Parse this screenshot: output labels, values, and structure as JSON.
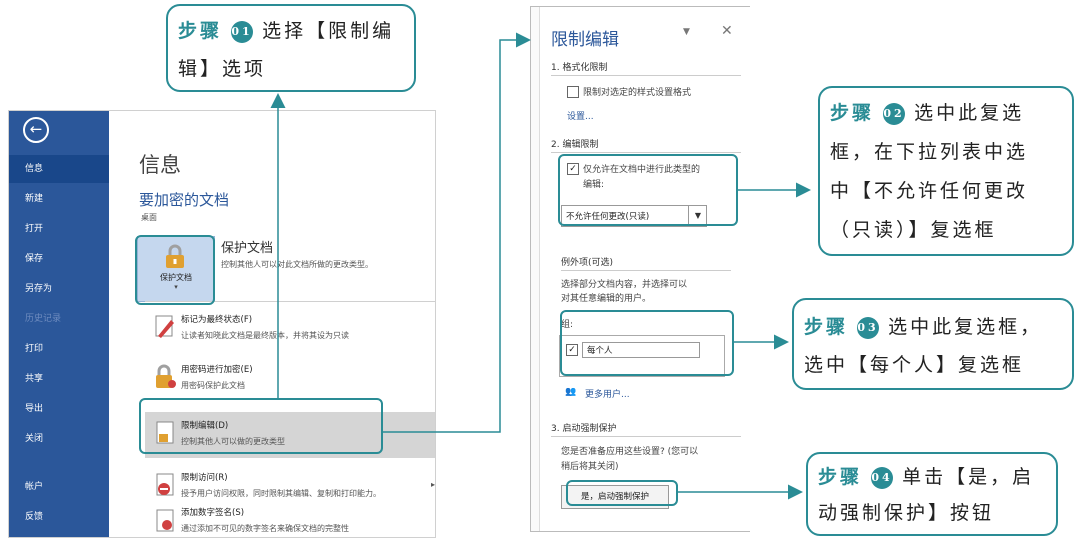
{
  "backstage": {
    "nav": [
      "信息",
      "新建",
      "打开",
      "保存",
      "另存为",
      "历史记录",
      "打印",
      "共享",
      "导出",
      "关闭",
      "帐户",
      "反馈"
    ],
    "info_title": "信息",
    "doc_name": "要加密的文档",
    "doc_location": "桌面",
    "protect_button_label": "保护文档",
    "protect_button_arrow": "▾",
    "protect_title": "保护文档",
    "protect_desc": "控制其他人可以对此文档所做的更改类型。",
    "menu": [
      {
        "title": "标记为最终状态(F)",
        "desc": "让读者知晓此文档是最终版本，并将其设为只读"
      },
      {
        "title": "用密码进行加密(E)",
        "desc": "用密码保护此文档"
      },
      {
        "title": "限制编辑(D)",
        "desc": "控制其他人可以做的更改类型"
      },
      {
        "title": "限制访问(R)",
        "desc": "授予用户访问权限，同时限制其编辑、复制和打印能力。"
      },
      {
        "title": "添加数字签名(S)",
        "desc": "通过添加不可见的数字签名来确保文档的完整性"
      }
    ]
  },
  "pane": {
    "title": "限制编辑",
    "sec1_head": "1. 格式化限制",
    "format_checkbox_label": "限制对选定的样式设置格式",
    "settings_link": "设置...",
    "sec2_head": "2. 编辑限制",
    "edit_checkbox_label_1": "仅允许在文档中进行此类型的",
    "edit_checkbox_label_2": "编辑:",
    "edit_select_value": "不允许任何更改(只读)",
    "exceptions_head": "例外项(可选)",
    "exceptions_desc_1": "选择部分文档内容，并选择可以",
    "exceptions_desc_2": "对其任意编辑的用户。",
    "groups_label": "组:",
    "everyone": "每个人",
    "more_users": "更多用户...",
    "sec3_head": "3. 启动强制保护",
    "enforce_desc_1": "您是否准备应用这些设置? (您可以",
    "enforce_desc_2": "稍后将其关闭)",
    "enforce_button": "是，启动强制保护"
  },
  "callouts": {
    "step_word": "步骤",
    "c1": {
      "num": "01",
      "line1": "选择【限制编",
      "line2": "辑】选项"
    },
    "c2": {
      "num": "02",
      "line1": "选中此复选",
      "line2": "框，在下拉列表中选",
      "line3": "中【不允许任何更改",
      "line4": "（只读）】复选框"
    },
    "c3": {
      "num": "03",
      "line1": "选中此复选框，",
      "line2": "选中【每个人】复选框"
    },
    "c4": {
      "num": "04",
      "line1": "单击【是，启",
      "line2": "动强制保护】按钮"
    }
  },
  "colors": {
    "accent": "#2a8c95",
    "word_blue": "#2b579a"
  }
}
